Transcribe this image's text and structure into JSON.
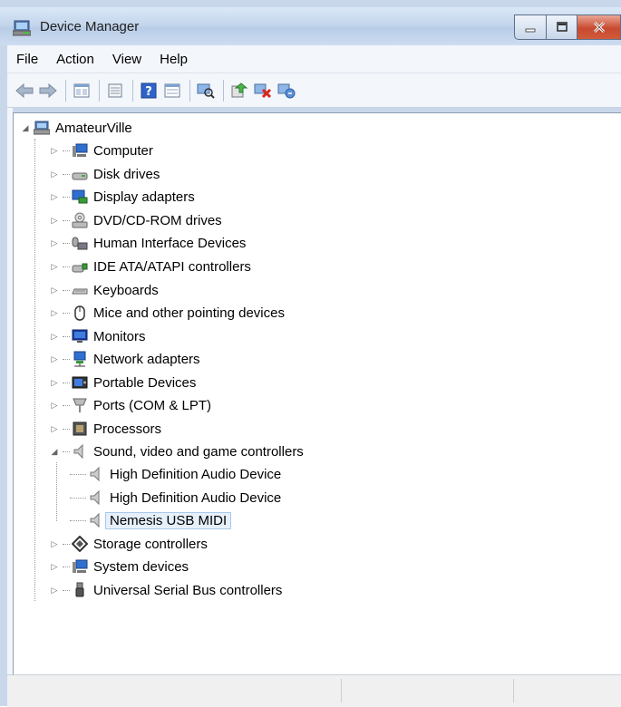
{
  "window": {
    "title": "Device Manager"
  },
  "menu": [
    {
      "label": "File"
    },
    {
      "label": "Action"
    },
    {
      "label": "View"
    },
    {
      "label": "Help"
    }
  ],
  "toolbar": [
    "back-icon",
    "forward-icon",
    "properties-view-icon",
    "show-hide-console-tree-icon",
    "help-icon",
    "properties-icon",
    "scan-hardware-icon",
    "update-driver-icon",
    "disable-device-icon",
    "uninstall-device-icon"
  ],
  "tree": {
    "root": "AmateurVille",
    "categories": [
      {
        "label": "Computer",
        "icon": "computer-icon"
      },
      {
        "label": "Disk drives",
        "icon": "disk-drive-icon"
      },
      {
        "label": "Display adapters",
        "icon": "display-adapter-icon"
      },
      {
        "label": "DVD/CD-ROM drives",
        "icon": "dvd-drive-icon"
      },
      {
        "label": "Human Interface Devices",
        "icon": "hid-icon"
      },
      {
        "label": "IDE ATA/ATAPI controllers",
        "icon": "ide-controller-icon"
      },
      {
        "label": "Keyboards",
        "icon": "keyboard-icon"
      },
      {
        "label": "Mice and other pointing devices",
        "icon": "mouse-icon"
      },
      {
        "label": "Monitors",
        "icon": "monitor-icon"
      },
      {
        "label": "Network adapters",
        "icon": "network-adapter-icon"
      },
      {
        "label": "Portable Devices",
        "icon": "portable-device-icon"
      },
      {
        "label": "Ports (COM & LPT)",
        "icon": "port-icon"
      },
      {
        "label": "Processors",
        "icon": "processor-icon"
      },
      {
        "label": "Sound, video and game controllers",
        "icon": "speaker-icon"
      },
      {
        "label": "Storage controllers",
        "icon": "storage-controller-icon"
      },
      {
        "label": "System devices",
        "icon": "system-device-icon"
      },
      {
        "label": "Universal Serial Bus controllers",
        "icon": "usb-icon"
      }
    ],
    "sound_children": [
      {
        "label": "High Definition Audio Device"
      },
      {
        "label": "High Definition Audio Device"
      },
      {
        "label": "Nemesis USB MIDI"
      }
    ]
  }
}
